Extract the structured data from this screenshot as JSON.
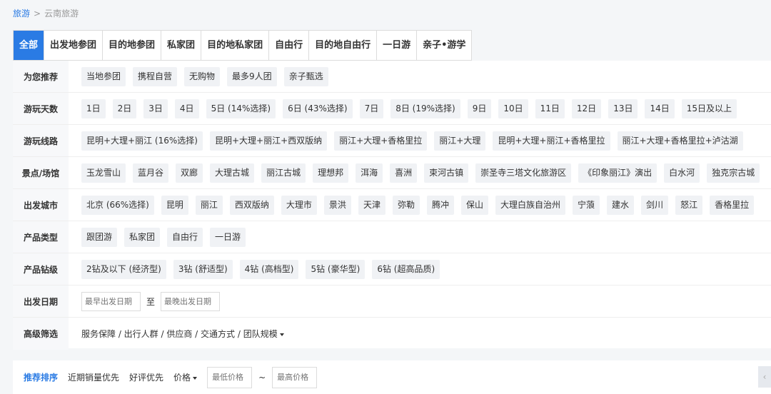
{
  "breadcrumb": {
    "root": "旅游",
    "separator": ">",
    "current": "云南旅游"
  },
  "tabs": [
    {
      "label": "全部"
    },
    {
      "label": "出发地参团"
    },
    {
      "label": "目的地参团"
    },
    {
      "label": "私家团"
    },
    {
      "label": "目的地私家团"
    },
    {
      "label": "自由行"
    },
    {
      "label": "目的地自由行"
    },
    {
      "label": "一日游"
    },
    {
      "label": "亲子•游学"
    }
  ],
  "filters": {
    "recommend": {
      "label": "为您推荐",
      "options": [
        "当地参团",
        "携程自营",
        "无购物",
        "最多9人团",
        "亲子甄选"
      ]
    },
    "days": {
      "label": "游玩天数",
      "options": [
        "1日",
        "2日",
        "3日",
        "4日",
        "5日 (14%选择)",
        "6日 (43%选择)",
        "7日",
        "8日 (19%选择)",
        "9日",
        "10日",
        "11日",
        "12日",
        "13日",
        "14日",
        "15日及以上"
      ]
    },
    "routes": {
      "label": "游玩线路",
      "options": [
        "昆明+大理+丽江 (16%选择)",
        "昆明+大理+丽江+西双版纳",
        "丽江+大理+香格里拉",
        "丽江+大理",
        "昆明+大理+丽江+香格里拉",
        "丽江+大理+香格里拉+泸沽湖"
      ]
    },
    "spots": {
      "label": "景点/场馆",
      "options": [
        "玉龙雪山",
        "蓝月谷",
        "双廊",
        "大理古城",
        "丽江古城",
        "理想邦",
        "洱海",
        "喜洲",
        "束河古镇",
        "崇圣寺三塔文化旅游区",
        "《印象丽江》演出",
        "白水河",
        "独克宗古城"
      ]
    },
    "departure": {
      "label": "出发城市",
      "options": [
        "北京 (66%选择)",
        "昆明",
        "丽江",
        "西双版纳",
        "大理市",
        "景洪",
        "天津",
        "弥勒",
        "腾冲",
        "保山",
        "大理白族自治州",
        "宁蒗",
        "建水",
        "剑川",
        "怒江",
        "香格里拉"
      ]
    },
    "product_type": {
      "label": "产品类型",
      "options": [
        "跟团游",
        "私家团",
        "自由行",
        "一日游"
      ]
    },
    "grade": {
      "label": "产品钻级",
      "options": [
        "2钻及以下 (经济型)",
        "3钻 (舒适型)",
        "4钻 (高档型)",
        "5钻 (豪华型)",
        "6钻 (超高品质)"
      ]
    },
    "date": {
      "label": "出发日期",
      "from_placeholder": "最早出发日期",
      "to_label": "至",
      "to_placeholder": "最晚出发日期"
    },
    "advanced": {
      "label": "高级筛选",
      "text": "服务保障 / 出行人群 / 供应商 / 交通方式 / 团队规模"
    }
  },
  "sort": {
    "items": [
      "推荐排序",
      "近期销量优先",
      "好评优先",
      "价格"
    ],
    "price_min_placeholder": "最低价格",
    "price_sep": "~",
    "price_max_placeholder": "最高价格"
  },
  "colors": {
    "accent": "#2a7be4",
    "chip_bg": "#f0f2f5",
    "label_bg": "#f7f8fa"
  }
}
